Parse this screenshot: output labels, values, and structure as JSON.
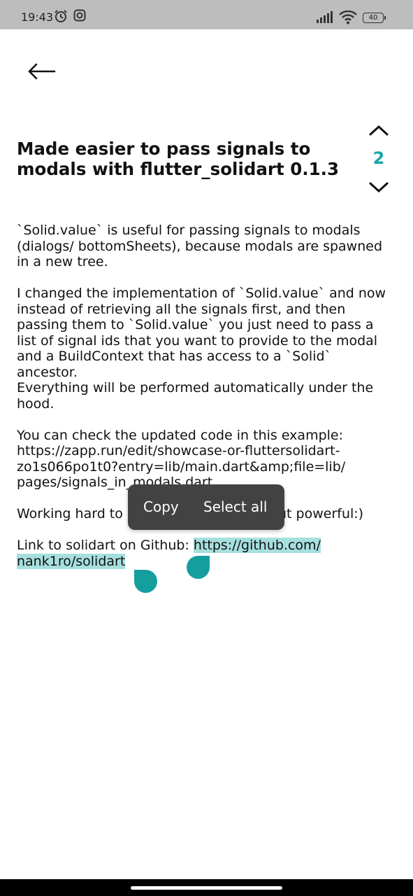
{
  "status_bar": {
    "time": "19:43",
    "battery": "40",
    "icons": [
      "alarm-icon",
      "instagram-icon",
      "signal-icon",
      "wifi-icon",
      "battery-icon"
    ]
  },
  "header": {
    "back_icon": "arrow-left-icon"
  },
  "post": {
    "title": "Made easier to pass signals to modals with flutter_solidart 0.1.3",
    "counter": "2",
    "accent_color": "#19a4a4",
    "paragraphs": {
      "p1": "`Solid.value` is useful for passing signals to modals (dialogs/ bottomSheets), because modals are spawned in a new tree.",
      "p2": "I changed the implementation of `Solid.value` and now instead of retrieving all the signals first, and then passing them to `Solid.value` you just need to pass a list of signal ids that you want to provide to the modal and a BuildContext that has access to a `Solid` ancestor.",
      "p3": "Everything will be performed automatically under the hood.",
      "p4": "You can check the updated code in this example: https://zapp.run/edit/showcase-or-fluttersolidart-zo1s066po1t0?entry=lib/main.dart&amp;file=lib/ pages/signals_in_modals.dart",
      "p5": "Working hard to make solidart simple but powerful:)",
      "p6_prefix": "Link to solidart on Github: ",
      "p6_link": "https://github.com/ nank1ro/solidart"
    }
  },
  "selection_popup": {
    "copy_label": "Copy",
    "select_all_label": "Select all",
    "highlight_color": "#a6e0de"
  }
}
